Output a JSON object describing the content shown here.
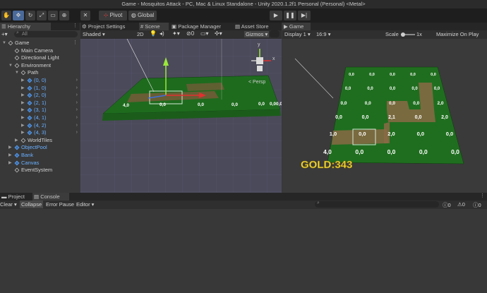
{
  "window_title": "Game - Mosquitos Attack - PC, Mac & Linux Standalone - Unity 2020.1.2f1 Personal (Personal) <Metal>",
  "toolbar": {
    "pivot_label": "Pivot",
    "global_label": "Global",
    "tools": [
      "hand-tool",
      "move-tool",
      "rotate-tool",
      "scale-tool",
      "rect-tool",
      "transform-tool",
      "custom-tool"
    ]
  },
  "hierarchy": {
    "tab_label": "Hierarchy",
    "search_placeholder": "All",
    "items": [
      {
        "label": "Game",
        "depth": 0,
        "expanded": true,
        "blue": false
      },
      {
        "label": "Main Camera",
        "depth": 1,
        "blue": false
      },
      {
        "label": "Directional Light",
        "depth": 1,
        "blue": false
      },
      {
        "label": "Environment",
        "depth": 1,
        "expanded": true,
        "blue": false
      },
      {
        "label": "Path",
        "depth": 2,
        "expanded": true,
        "blue": false
      },
      {
        "label": "(0, 0)",
        "depth": 3,
        "blue": true
      },
      {
        "label": "(1, 0)",
        "depth": 3,
        "blue": true
      },
      {
        "label": "(2, 0)",
        "depth": 3,
        "blue": true
      },
      {
        "label": "(2, 1)",
        "depth": 3,
        "blue": true
      },
      {
        "label": "(3, 1)",
        "depth": 3,
        "blue": true
      },
      {
        "label": "(4, 1)",
        "depth": 3,
        "blue": true
      },
      {
        "label": "(4, 2)",
        "depth": 3,
        "blue": true
      },
      {
        "label": "(4, 3)",
        "depth": 3,
        "blue": true
      },
      {
        "label": "WorldTiles",
        "depth": 2,
        "blue": false
      },
      {
        "label": "ObjectPool",
        "depth": 1,
        "blue": true
      },
      {
        "label": "Bank",
        "depth": 1,
        "blue": true
      },
      {
        "label": "Canvas",
        "depth": 1,
        "blue": true
      },
      {
        "label": "EventSystem",
        "depth": 1,
        "blue": false
      }
    ]
  },
  "scene_panel": {
    "tabs": [
      "Project Settings",
      "Scene",
      "Package Manager",
      "Asset Store"
    ],
    "shading_mode": "Shaded",
    "mode_2d": "2D",
    "gizmos_label": "Gizmos",
    "persp_label": "< Persp",
    "tile_labels": [
      "4,0",
      "0,0",
      "0,0",
      "0,0",
      "0,0",
      "0,0",
      "0,0"
    ]
  },
  "game_panel": {
    "tab_label": "Game",
    "display": "Display 1",
    "aspect": "16:9",
    "scale_label": "Scale",
    "scale_value": "1x",
    "maximize_label": "Maximize On Play",
    "gold_text": "GOLD:343",
    "tile_rows": [
      [
        "0,0",
        "0,0",
        "0,0",
        "0,0",
        "0,0"
      ],
      [
        "0,0",
        "0,0",
        "0,0",
        "0,0",
        "0,0"
      ],
      [
        "0,0",
        "0,0",
        "0,0",
        "0,0",
        "2,0"
      ],
      [
        "0,0",
        "0,0",
        "2,1",
        "0,0",
        "2,0"
      ],
      [
        "1,0",
        "0,0",
        "2,0",
        "0,0",
        "0,0"
      ],
      [
        "4,0",
        "0,0",
        "0,0",
        "0,0",
        "0,0"
      ]
    ]
  },
  "bottom": {
    "tabs": [
      "Project",
      "Console"
    ],
    "buttons": [
      "Clear",
      "Collapse",
      "Error Pause",
      "Editor"
    ],
    "counts": [
      "0",
      "0",
      "0"
    ]
  }
}
